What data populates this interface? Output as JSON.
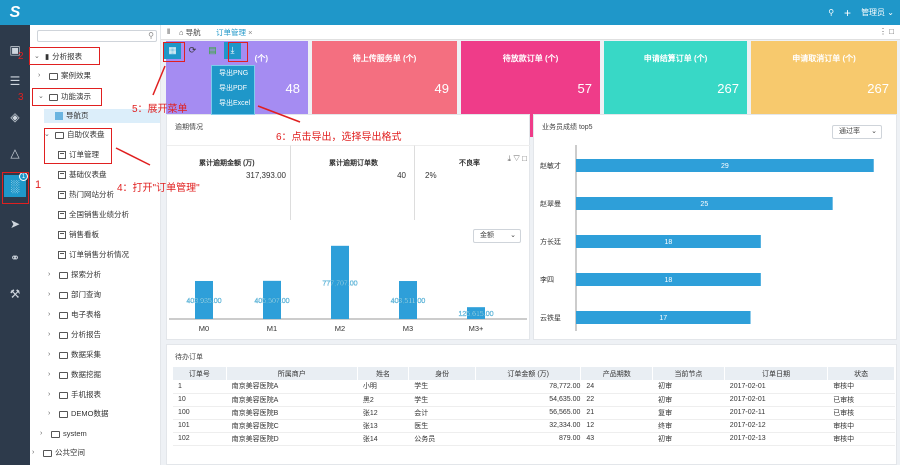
{
  "topbar": {
    "user": "管理员",
    "search_icon": "search-icon",
    "add_icon": "plus-icon",
    "chevron": "chevron-down-icon"
  },
  "colors": {
    "accent": "#1f97c9",
    "kpi1": "#a58cf2",
    "kpi2": "#f46f80",
    "kpi3": "#ef3c89",
    "kpi4": "#38d8c6",
    "kpi5": "#f7c96d",
    "bar": "#2e9fd9",
    "annotation": "#e02020"
  },
  "tree": {
    "search_placeholder": "",
    "items": [
      {
        "label": "分析报表"
      },
      {
        "label": "案例效果"
      },
      {
        "label": "功能演示"
      },
      {
        "label": "导航页"
      },
      {
        "label": "自助仪表盘"
      },
      {
        "label": "订单管理"
      },
      {
        "label": "基础仪表盘"
      },
      {
        "label": "热门网站分析"
      },
      {
        "label": "全国销售业绩分析"
      },
      {
        "label": "销售看板"
      },
      {
        "label": "订单销售分析情况"
      },
      {
        "label": "探索分析"
      },
      {
        "label": "部门查询"
      },
      {
        "label": "电子表格"
      },
      {
        "label": "分析报告"
      },
      {
        "label": "数据采集"
      },
      {
        "label": "数据挖掘"
      },
      {
        "label": "手机报表"
      },
      {
        "label": "DEMO数据"
      },
      {
        "label": "system"
      },
      {
        "label": "公共空间"
      }
    ]
  },
  "tabs": {
    "nav": "导航",
    "current": "订单管理"
  },
  "kpis": [
    {
      "title": "(个)",
      "value": "48"
    },
    {
      "title": "待上传服务单 (个)",
      "value": "49"
    },
    {
      "title": "待放款订单 (个)",
      "value": "57"
    },
    {
      "title": "申请结算订单 (个)",
      "value": "267"
    },
    {
      "title": "申请取消订单 (个)",
      "value": "267"
    }
  ],
  "export_menu": {
    "png": "导出PNG",
    "pdf": "导出PDF",
    "excel": "导出Excel"
  },
  "overdue": {
    "title": "逾期情况",
    "cols": [
      {
        "label": "累计逾期金额 (万)",
        "value": "317,393.00"
      },
      {
        "label": "累计逾期订单数",
        "value": "40"
      },
      {
        "label": "不良率",
        "value": "2%"
      }
    ],
    "select": "金额"
  },
  "chart_data": [
    {
      "type": "bar",
      "categories": [
        "M0",
        "M1",
        "M2",
        "M3",
        "M3+"
      ],
      "values": [
        403935,
        405507,
        777707,
        403511,
        125615
      ],
      "data_labels": [
        "403,935.00",
        "405,507.00",
        "777,707.00",
        "403,511.00",
        "125,615.00"
      ],
      "ylim": [
        0,
        850000
      ]
    },
    {
      "type": "bar",
      "orientation": "horizontal",
      "title": "业务员成绩 top5",
      "categories": [
        "赵敏才",
        "赵翠曼",
        "方长廷",
        "李四",
        "云铁星"
      ],
      "values": [
        29,
        25,
        18,
        18,
        17
      ],
      "xlim": [
        0,
        30
      ],
      "select": "通过率"
    }
  ],
  "orders": {
    "title": "待办订单",
    "headers": [
      "订单号",
      "所属商户",
      "姓名",
      "身份",
      "订单金额 (万)",
      "产品期数",
      "当前节点",
      "订单日期",
      "状态"
    ],
    "rows": [
      [
        "1",
        "南京美容医院A",
        "小明",
        "学生",
        "78,772.00",
        "24",
        "初审",
        "2017-02-01",
        "审核中"
      ],
      [
        "10",
        "南京美容医院A",
        "黑2",
        "学生",
        "54,635.00",
        "22",
        "初审",
        "2017-02-01",
        "已审核"
      ],
      [
        "100",
        "南京美容医院B",
        "张12",
        "会计",
        "56,565.00",
        "21",
        "复审",
        "2017-02-11",
        "已审核"
      ],
      [
        "101",
        "南京美容医院C",
        "张13",
        "医生",
        "32,334.00",
        "12",
        "终审",
        "2017-02-12",
        "审核中"
      ],
      [
        "102",
        "南京美容医院D",
        "张14",
        "公务员",
        "879.00",
        "43",
        "初审",
        "2017-02-13",
        "审核中"
      ]
    ]
  },
  "annotations": {
    "a1": "1",
    "a2": "2",
    "a3": "3",
    "a4": "4：打开\"订单管理\"",
    "a5": "5：展开菜单",
    "a6": "6：点击导出，选择导出格式"
  }
}
